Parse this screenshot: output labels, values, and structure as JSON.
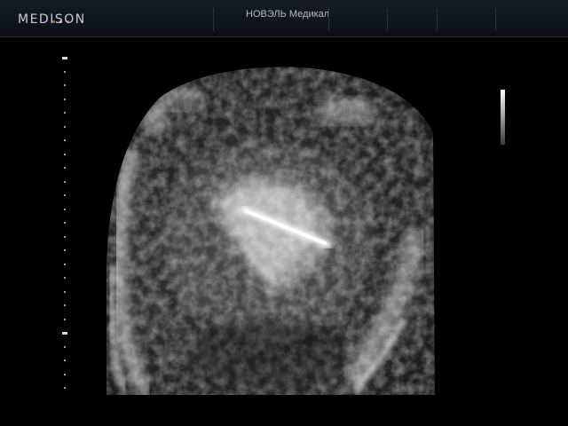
{
  "header": {
    "brand": "MEDISON",
    "institution": "НОВЭЛЬ Медикал"
  },
  "colors": {
    "background": "#000000",
    "header_bg": "#12171e",
    "brand_dot_1": "#d9534f",
    "brand_dot_2": "#f0c24b",
    "brand_dot_3": "#d9534f"
  },
  "icons": {
    "depth_scale": "depth-scale-icon",
    "gray_map": "gray-map-bar-icon"
  }
}
